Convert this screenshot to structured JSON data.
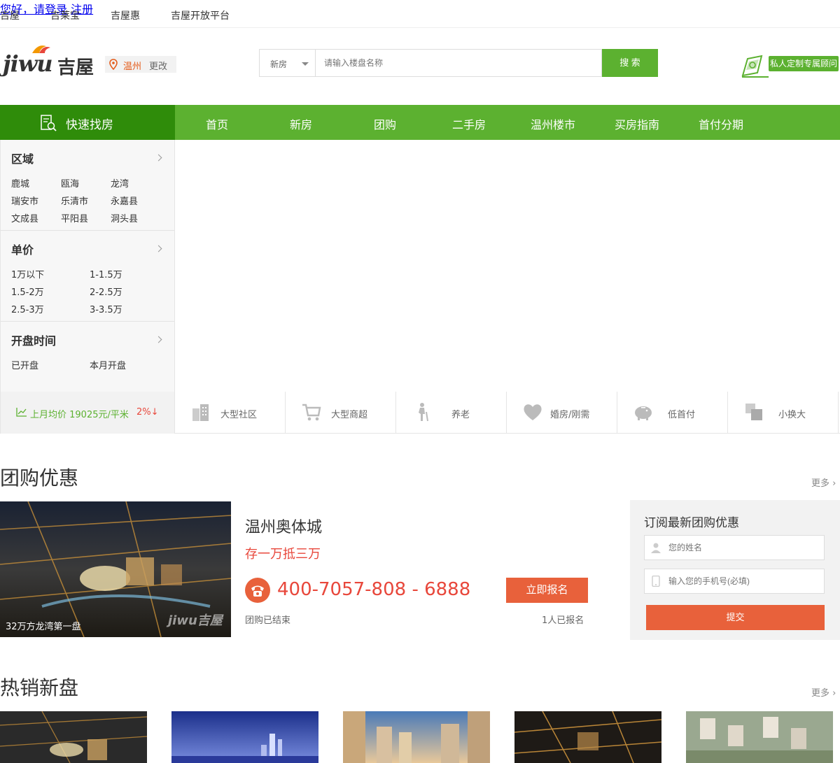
{
  "topbar": {
    "links": [
      "吉屋",
      "吉莱宝",
      "吉屋惠",
      "吉屋开放平台"
    ],
    "login": "您好，请登录",
    "register": "注册"
  },
  "header": {
    "logo_text": "jiwu",
    "logo_cn": "吉屋",
    "city": "温州",
    "change": "更改",
    "search_type": "新房",
    "search_placeholder": "请输入楼盘名称",
    "search_button": "搜 索",
    "advisor": "私人定制专属顾问"
  },
  "nav": {
    "quick": "快速找房",
    "items": [
      "首页",
      "新房",
      "团购",
      "二手房",
      "温州楼市",
      "买房指南",
      "首付分期"
    ]
  },
  "filters": {
    "region": {
      "title": "区域",
      "items": [
        "鹿城",
        "瓯海",
        "龙湾",
        "瑞安市",
        "乐清市",
        "永嘉县",
        "文成县",
        "平阳县",
        "洞头县"
      ]
    },
    "price": {
      "title": "单价",
      "items": [
        "1万以下",
        "1-1.5万",
        "1.5-2万",
        "2-2.5万",
        "2.5-3万",
        "3-3.5万"
      ]
    },
    "opening": {
      "title": "开盘时间",
      "items": [
        "已开盘",
        "本月开盘"
      ]
    },
    "avg_price": "上月均价 19025元/平米",
    "avg_change": "2%↓"
  },
  "features": [
    "大型社区",
    "大型商超",
    "养老",
    "婚房/刚需",
    "低首付",
    "小换大"
  ],
  "groupbuy": {
    "title": "团购优惠",
    "more": "更多",
    "caption": "32万方龙湾第一盘",
    "watermark": "jiwu吉屋",
    "name": "温州奥体城",
    "promo": "存一万抵三万",
    "phone": "400-7057-808 - 6888",
    "status": "团购已结束",
    "signup": "立即报名",
    "count": "1人已报名"
  },
  "subscribe": {
    "title": "订阅最新团购优惠",
    "name_placeholder": "您的姓名",
    "phone_placeholder": "输入您的手机号(必填)",
    "submit": "提交"
  },
  "hot": {
    "title": "热销新盘",
    "more": "更多"
  },
  "colors": {
    "green": "#5cb130",
    "dark_green": "#2f8c0a",
    "orange": "#e8613b",
    "red": "#e8473b"
  }
}
